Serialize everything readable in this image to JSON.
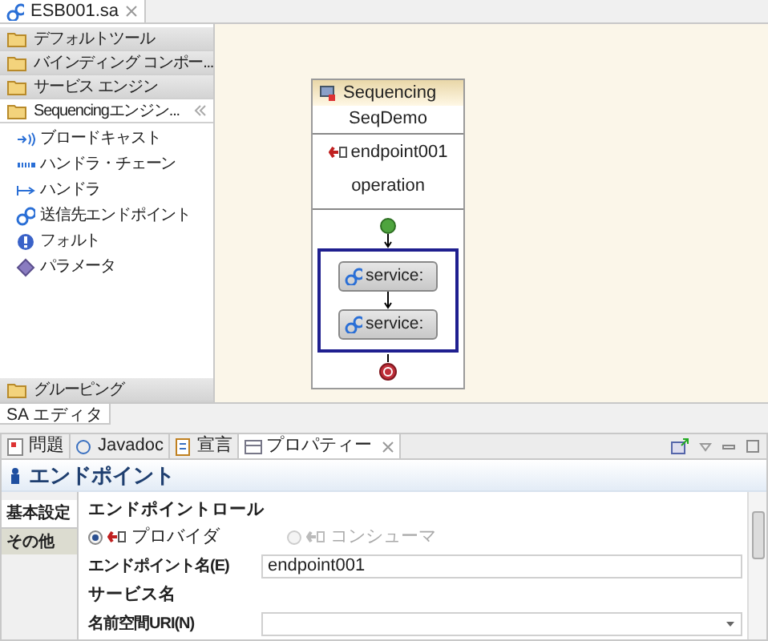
{
  "editor_tabs": [
    {
      "label": "ESB001.sa",
      "selected": true
    }
  ],
  "palette": {
    "drawers": [
      {
        "label": "デフォルトツール",
        "expanded": false
      },
      {
        "label": "バインディング コンポー...",
        "expanded": false
      },
      {
        "label": "サービス エンジン",
        "expanded": false
      },
      {
        "label": "Sequencingエンジン...",
        "expanded": true,
        "items": [
          {
            "label": "ブロードキャスト",
            "kind": "broadcast"
          },
          {
            "label": "ハンドラ・チェーン",
            "kind": "chain"
          },
          {
            "label": "ハンドラ",
            "kind": "handler"
          },
          {
            "label": "送信先エンドポイント",
            "kind": "endpoint"
          },
          {
            "label": "フォルト",
            "kind": "fault"
          },
          {
            "label": "パラメータ",
            "kind": "parameter"
          }
        ]
      }
    ],
    "bottom_drawer": {
      "label": "グルーピング",
      "expanded": false
    }
  },
  "diagram": {
    "title": "Sequencing",
    "name": "SeqDemo",
    "endpoint": "endpoint001",
    "operation": "operation",
    "services": [
      "service:",
      "service:"
    ]
  },
  "editor_page_tabs": [
    {
      "label": "SA エディタ",
      "selected": true
    }
  ],
  "view_tabs": [
    {
      "label": "問題",
      "kind": "problems",
      "selected": false
    },
    {
      "label": "Javadoc",
      "kind": "javadoc",
      "selected": false
    },
    {
      "label": "宣言",
      "kind": "declaration",
      "selected": false
    },
    {
      "label": "プロパティー",
      "kind": "properties",
      "selected": true
    }
  ],
  "properties": {
    "title": "エンドポイント",
    "side_tabs": [
      {
        "label": "基本設定",
        "selected": true
      },
      {
        "label": "その他",
        "selected": false
      }
    ],
    "role_label": "エンドポイントロール",
    "roles": [
      {
        "label": "プロバイダ",
        "selected": true,
        "disabled": false
      },
      {
        "label": "コンシューマ",
        "selected": false,
        "disabled": true
      }
    ],
    "name_label": "エンドポイント名(E)",
    "name_value": "endpoint001",
    "service_label": "サービス名",
    "namespace_label": "名前空間URI(N)"
  }
}
